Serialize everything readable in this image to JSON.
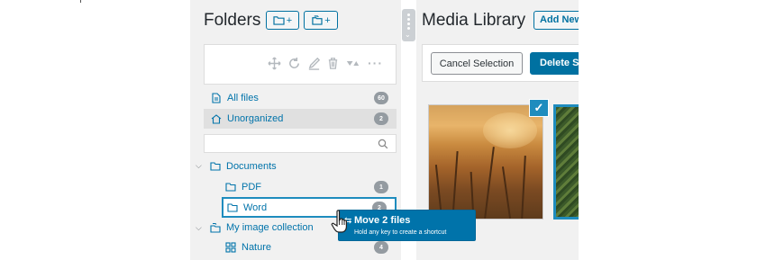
{
  "sidebar": {
    "title": "Folders",
    "add_folder_label": "+",
    "add_collection_label": "+",
    "toolbar_icons": [
      "move-icon",
      "refresh-icon",
      "edit-icon",
      "trash-icon",
      "sort-icon",
      "more-icon"
    ],
    "toolbar_more": "···",
    "search": {
      "placeholder": "",
      "value": ""
    },
    "items": [
      {
        "label": "All files",
        "count": "60",
        "icon": "file-icon"
      },
      {
        "label": "Unorganized",
        "count": "2",
        "icon": "home-icon"
      },
      {
        "label": "Documents",
        "count": "",
        "icon": "folder-icon"
      },
      {
        "label": "PDF",
        "count": "1",
        "icon": "folder-icon"
      },
      {
        "label": "Word",
        "count": "2",
        "icon": "folder-icon"
      },
      {
        "label": "My image collection",
        "count": "",
        "icon": "collection-icon"
      },
      {
        "label": "Nature",
        "count": "4",
        "icon": "gallery-icon"
      }
    ]
  },
  "main": {
    "title": "Media Library",
    "add_new": "Add New",
    "cancel_selection": "Cancel Selection",
    "delete_selected": "Delete Selected"
  },
  "drag_tooltip": {
    "title": "Move 2 files",
    "hint": "Hold any key to create a shortcut"
  },
  "colors": {
    "accent": "#0073aa",
    "panel_bg": "#f1f1f1",
    "badge": "#949ba1",
    "selected_row": "#e0e0e0"
  }
}
